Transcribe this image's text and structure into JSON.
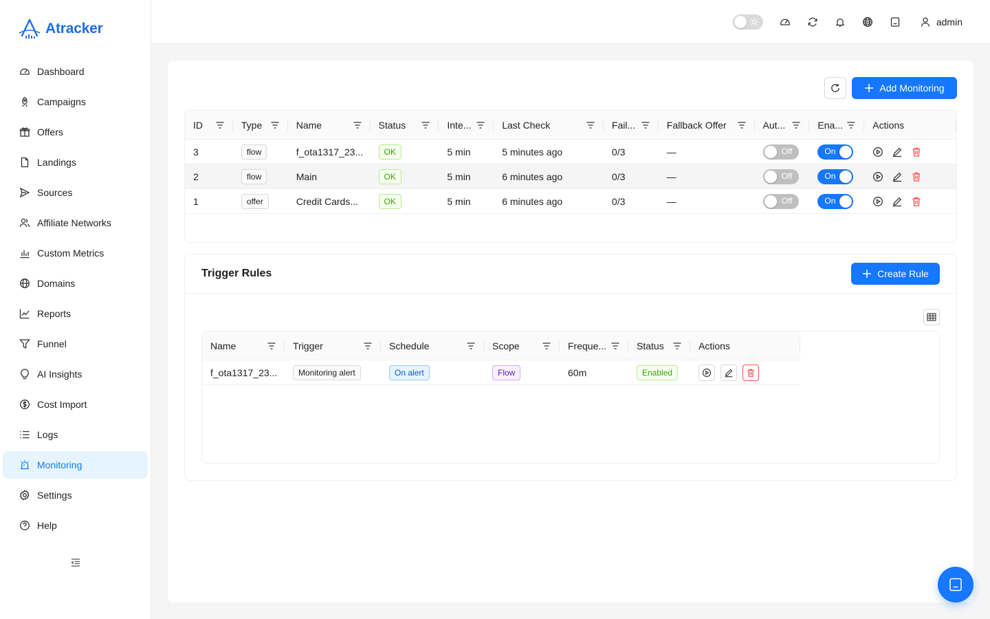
{
  "app": {
    "name": "Atracker"
  },
  "nav": [
    {
      "label": "Dashboard",
      "icon": "dashboard-icon",
      "active": false
    },
    {
      "label": "Campaigns",
      "icon": "rocket-icon",
      "active": false
    },
    {
      "label": "Offers",
      "icon": "gift-icon",
      "active": false
    },
    {
      "label": "Landings",
      "icon": "file-icon",
      "active": false
    },
    {
      "label": "Sources",
      "icon": "send-icon",
      "active": false
    },
    {
      "label": "Affiliate Networks",
      "icon": "users-icon",
      "active": false
    },
    {
      "label": "Custom Metrics",
      "icon": "bar-chart-icon",
      "active": false
    },
    {
      "label": "Domains",
      "icon": "globe-icon",
      "active": false
    },
    {
      "label": "Reports",
      "icon": "line-chart-icon",
      "active": false
    },
    {
      "label": "Funnel",
      "icon": "funnel-icon",
      "active": false
    },
    {
      "label": "AI Insights",
      "icon": "bulb-icon",
      "active": false
    },
    {
      "label": "Cost Import",
      "icon": "dollar-icon",
      "active": false
    },
    {
      "label": "Logs",
      "icon": "list-icon",
      "active": false
    },
    {
      "label": "Monitoring",
      "icon": "alarm-icon",
      "active": true
    },
    {
      "label": "Settings",
      "icon": "gear-icon",
      "active": false
    },
    {
      "label": "Help",
      "icon": "question-icon",
      "active": false
    }
  ],
  "header": {
    "user_name": "admin"
  },
  "monitoring": {
    "add_button": "Add Monitoring",
    "columns": [
      "ID",
      "Type",
      "Name",
      "Status",
      "Inte...",
      "Last Check",
      "Fail...",
      "Fallback Offer",
      "Aut...",
      "Ena...",
      "Actions"
    ],
    "rows": [
      {
        "id": "3",
        "type": "flow",
        "name": "f_ota1317_23...",
        "status": "OK",
        "interval": "5 min",
        "last_check": "5 minutes ago",
        "fails": "0/3",
        "fallback": "—",
        "auto": "Off",
        "enabled": "On"
      },
      {
        "id": "2",
        "type": "flow",
        "name": "Main",
        "status": "OK",
        "interval": "5 min",
        "last_check": "6 minutes ago",
        "fails": "0/3",
        "fallback": "—",
        "auto": "Off",
        "enabled": "On"
      },
      {
        "id": "1",
        "type": "offer",
        "name": "Credit Cards...",
        "status": "OK",
        "interval": "5 min",
        "last_check": "6 minutes ago",
        "fails": "0/3",
        "fallback": "—",
        "auto": "Off",
        "enabled": "On"
      }
    ]
  },
  "rules": {
    "title": "Trigger Rules",
    "create_button": "Create Rule",
    "columns": [
      "Name",
      "Trigger",
      "Schedule",
      "Scope",
      "Freque...",
      "Status",
      "Actions"
    ],
    "rows": [
      {
        "name": "f_ota1317_23...",
        "trigger": "Monitoring alert",
        "schedule": "On alert",
        "scope": "Flow",
        "frequency": "60m",
        "status": "Enabled"
      }
    ]
  }
}
